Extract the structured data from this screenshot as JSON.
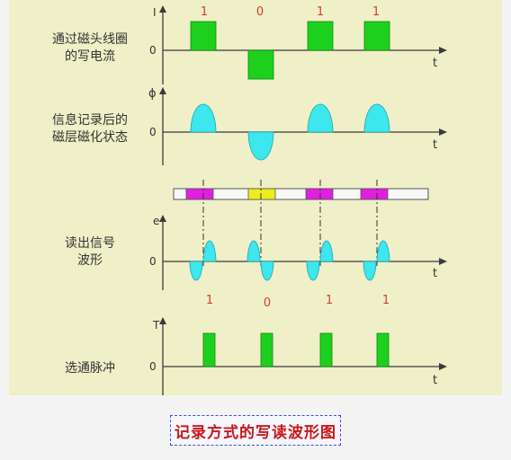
{
  "colors": {
    "background": "#efefc8",
    "pulse_green": "#1ed01e",
    "wave_cyan": "#3ee6ee",
    "mark_magenta": "#e01ee0",
    "mark_yellow": "#ecec1e",
    "bit_label": "#d04030",
    "axis": "#3a3a3a"
  },
  "rows": {
    "write_current": {
      "label_lines": [
        "通过磁头线圈",
        "的写电流"
      ],
      "y_symbol": "I",
      "zero": "0",
      "t": "t"
    },
    "magnetization": {
      "label_lines": [
        "信息记录后的",
        "磁层磁化状态"
      ],
      "y_symbol": "ϕ",
      "zero": "0",
      "t": "t"
    },
    "read_waveform": {
      "label_lines": [
        "读出信号",
        "波形"
      ],
      "y_symbol": "e",
      "zero": "0",
      "t": "t"
    },
    "strobe": {
      "label_lines": [
        "选通脉冲"
      ],
      "y_symbol": "T",
      "zero": "0",
      "t": "t"
    }
  },
  "bits": [
    "1",
    "0",
    "1",
    "1"
  ],
  "caption": "记录方式的写读波形图"
}
